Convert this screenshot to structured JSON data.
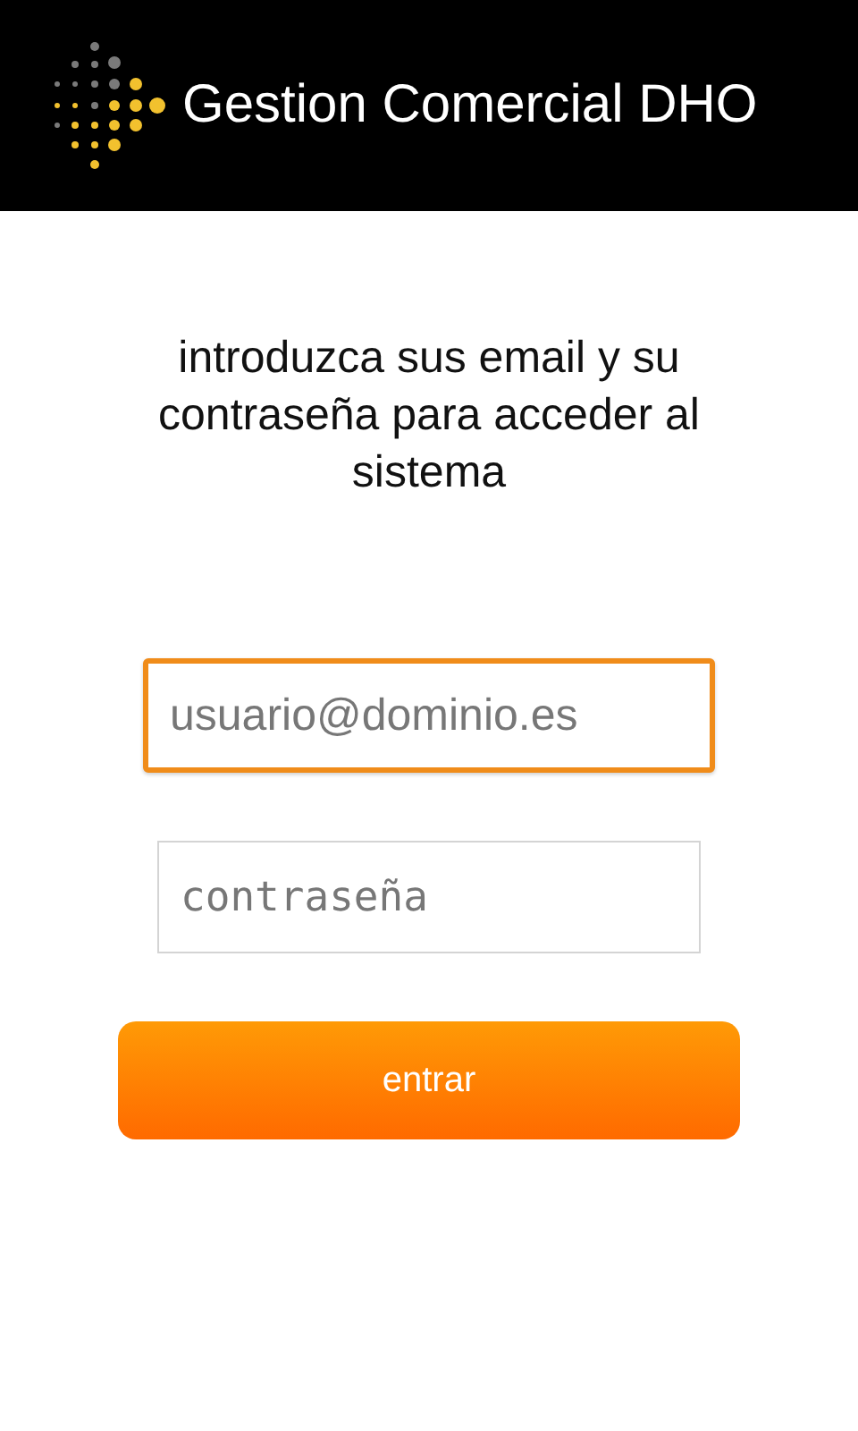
{
  "header": {
    "title": "Gestion Comercial DHO"
  },
  "instructions": "introduzca sus email y su contraseña para acceder al sistema",
  "fields": [
    {
      "kind": "email",
      "placeholder": "usuario@dominio.es",
      "focused": true
    },
    {
      "kind": "password",
      "placeholder": "contraseña",
      "focused": false
    }
  ],
  "button": {
    "label": "entrar"
  }
}
